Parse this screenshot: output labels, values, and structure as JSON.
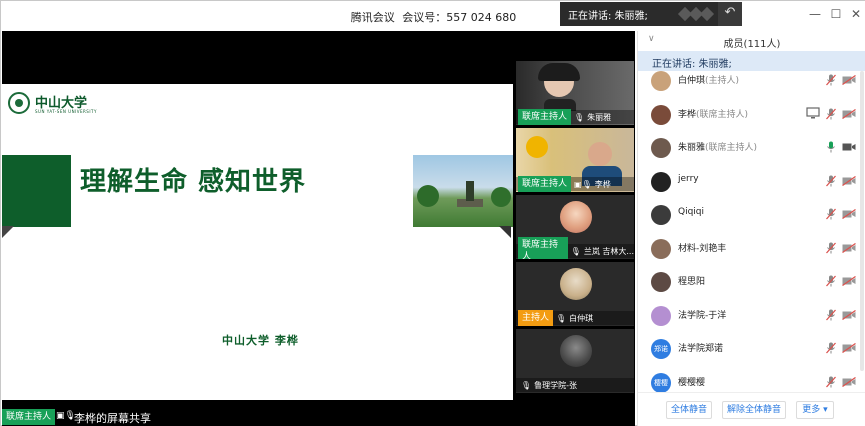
{
  "window": {
    "title": "腾讯会议",
    "meeting_label": "会议号：557 024 680"
  },
  "toast": {
    "speaking": "正在讲话: 朱丽雅;"
  },
  "slide": {
    "logo_text": "中山大学",
    "logo_sub": "SUN YAT-SEN UNIVERSITY",
    "title": "理解生命  感知世界",
    "author": "中山大学    李桦"
  },
  "share_bar": {
    "role": "联席主持人",
    "text": "李桦的屏幕共享"
  },
  "tiles": [
    {
      "role": "联席主持人",
      "name": "朱丽雅",
      "role_color": "#18a058"
    },
    {
      "role": "联席主持人",
      "name": "李桦",
      "role_color": "#18a058"
    },
    {
      "role": "联席主持人",
      "name": "兰岚 吉林大...",
      "role_color": "#18a058"
    },
    {
      "role": "主持人",
      "name": "白仲琪",
      "role_color": "#f39c12"
    },
    {
      "role": "",
      "name": "鲁理学院-张",
      "role_color": ""
    }
  ],
  "panel": {
    "header": "成员(111人)",
    "speaking": "正在讲话: 朱丽雅;",
    "members": [
      {
        "name": "白仲琪",
        "role": "(主持人)",
        "mic": "muted",
        "cam": "off",
        "share": false,
        "avatar": "#c9a27a"
      },
      {
        "name": "李桦",
        "role": "(联席主持人)",
        "mic": "muted",
        "cam": "off",
        "share": true,
        "avatar": "#7a4b3a"
      },
      {
        "name": "朱丽雅",
        "role": "(联席主持人)",
        "mic": "on",
        "cam": "on",
        "share": false,
        "avatar": "#6e5a4e"
      },
      {
        "name": "jerry",
        "role": "",
        "mic": "muted",
        "cam": "off",
        "share": false,
        "avatar": "#222222"
      },
      {
        "name": "Qiqiqi",
        "role": "",
        "mic": "muted",
        "cam": "off",
        "share": false,
        "avatar": "#3b3b3b"
      },
      {
        "name": "材料-刘艳丰",
        "role": "",
        "mic": "muted",
        "cam": "off",
        "share": false,
        "avatar": "#8a6d5a"
      },
      {
        "name": "程思阳",
        "role": "",
        "mic": "muted",
        "cam": "off",
        "share": false,
        "avatar": "#5d4a44"
      },
      {
        "name": "法学院-于洋",
        "role": "",
        "mic": "muted",
        "cam": "off",
        "share": false,
        "avatar": "#b48fd1"
      },
      {
        "name": "法学院郑诺",
        "role": "",
        "mic": "muted",
        "cam": "off",
        "share": false,
        "avatar": "#2f7de1",
        "initials": "郑诺"
      },
      {
        "name": "樱樱樱",
        "role": "",
        "mic": "muted",
        "cam": "off",
        "share": false,
        "avatar": "#2f7de1",
        "initials": "樱樱"
      }
    ],
    "footer": {
      "mute_all": "全体静音",
      "unmute_all": "解除全体静音",
      "more": "更多 ▾"
    }
  }
}
